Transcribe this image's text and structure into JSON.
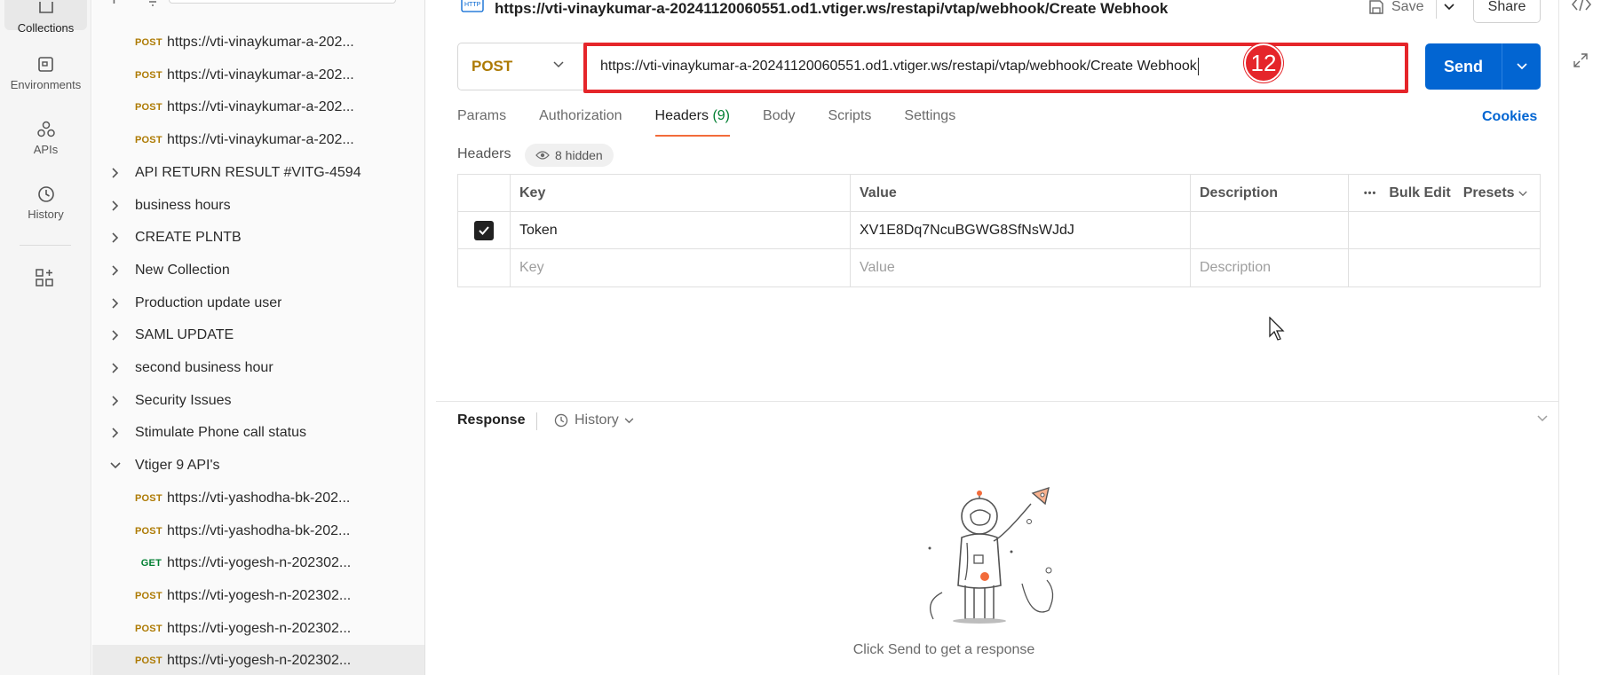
{
  "rail": {
    "items": [
      {
        "label": "Collections",
        "icon": "collections-icon"
      },
      {
        "label": "Environments",
        "icon": "environments-icon"
      },
      {
        "label": "APIs",
        "icon": "apis-icon"
      },
      {
        "label": "History",
        "icon": "history-icon"
      }
    ]
  },
  "sidebar": {
    "items": [
      {
        "kind": "request",
        "method": "POST",
        "text": "https://vti-vinaykumar-a-202..."
      },
      {
        "kind": "request",
        "method": "POST",
        "text": "https://vti-vinaykumar-a-202..."
      },
      {
        "kind": "request",
        "method": "POST",
        "text": "https://vti-vinaykumar-a-202..."
      },
      {
        "kind": "request",
        "method": "POST",
        "text": "https://vti-vinaykumar-a-202..."
      },
      {
        "kind": "folder",
        "text": "API RETURN RESULT #VITG-4594"
      },
      {
        "kind": "folder",
        "text": "business hours"
      },
      {
        "kind": "folder",
        "text": "CREATE PLNTB"
      },
      {
        "kind": "folder",
        "text": "New Collection"
      },
      {
        "kind": "folder",
        "text": "Production update user"
      },
      {
        "kind": "folder",
        "text": "SAML UPDATE"
      },
      {
        "kind": "folder",
        "text": "second business hour"
      },
      {
        "kind": "folder",
        "text": "Security Issues"
      },
      {
        "kind": "folder",
        "text": "Stimulate Phone call status"
      },
      {
        "kind": "folder-open",
        "text": "Vtiger 9 API's"
      },
      {
        "kind": "request",
        "method": "POST",
        "text": "https://vti-yashodha-bk-202..."
      },
      {
        "kind": "request",
        "method": "POST",
        "text": "https://vti-yashodha-bk-202..."
      },
      {
        "kind": "request",
        "method": "GET",
        "text": "https://vti-yogesh-n-202302..."
      },
      {
        "kind": "request",
        "method": "POST",
        "text": "https://vti-yogesh-n-202302..."
      },
      {
        "kind": "request",
        "method": "POST",
        "text": "https://vti-yogesh-n-202302..."
      },
      {
        "kind": "request",
        "method": "POST",
        "text": "https://vti-yogesh-n-202302...",
        "selected": true
      }
    ]
  },
  "toolbar": {
    "title": "https://vti-vinaykumar-a-20241120060551.od1.vtiger.ws/restapi/vtap/webhook/Create Webhook",
    "save_label": "Save",
    "share_label": "Share"
  },
  "request": {
    "method": "POST",
    "url": "https://vti-vinaykumar-a-20241120060551.od1.vtiger.ws/restapi/vtap/webhook/Create Webhook",
    "send_label": "Send",
    "step_badge": "12"
  },
  "tabs": {
    "items": [
      {
        "label": "Params"
      },
      {
        "label": "Authorization"
      },
      {
        "label": "Headers",
        "count": "(9)",
        "active": true
      },
      {
        "label": "Body"
      },
      {
        "label": "Scripts"
      },
      {
        "label": "Settings"
      }
    ],
    "cookies_label": "Cookies"
  },
  "headers": {
    "label": "Headers",
    "hidden_label": "8 hidden",
    "columns": {
      "key": "Key",
      "value": "Value",
      "description": "Description",
      "bulk_edit": "Bulk Edit",
      "presets": "Presets"
    },
    "rows": [
      {
        "key": "Token",
        "value": "XV1E8Dq7NcuBGWG8SfNsWJdJ",
        "description": "",
        "checked": true
      }
    ],
    "placeholder": {
      "key": "Key",
      "value": "Value",
      "description": "Description"
    }
  },
  "response": {
    "label": "Response",
    "history_label": "History",
    "empty_message": "Click Send to get a response"
  },
  "colors": {
    "accent_blue": "#0265d2",
    "post_method": "#ad7a03",
    "get_method": "#007f31",
    "highlight_red": "#e5252a",
    "active_tab_underline": "#f26b3a"
  }
}
